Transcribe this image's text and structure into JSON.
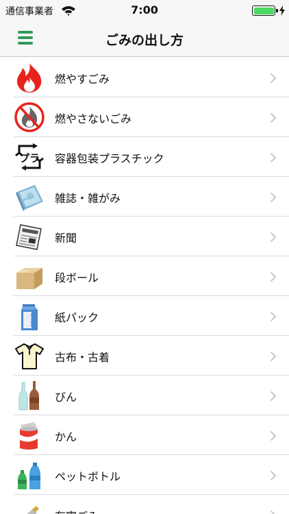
{
  "status_bar": {
    "carrier": "通信事業者",
    "time": "7:00",
    "battery_color": "#4cd964"
  },
  "nav": {
    "title": "ごみの出し方",
    "menu_icon": "hamburger-menu-icon",
    "accent_color": "#2e9a5c"
  },
  "categories": [
    {
      "label": "燃やすごみ",
      "icon": "flame-icon"
    },
    {
      "label": "燃やさないごみ",
      "icon": "no-burn-icon"
    },
    {
      "label": "容器包装プラスチック",
      "icon": "plastic-recycle-icon",
      "icon_text": "プラ"
    },
    {
      "label": "雑誌・雑がみ",
      "icon": "magazine-icon"
    },
    {
      "label": "新聞",
      "icon": "newspaper-icon"
    },
    {
      "label": "段ボール",
      "icon": "cardboard-box-icon"
    },
    {
      "label": "紙パック",
      "icon": "milk-carton-icon",
      "icon_text": "MILK"
    },
    {
      "label": "古布・古着",
      "icon": "shirt-icon"
    },
    {
      "label": "びん",
      "icon": "bottles-icon"
    },
    {
      "label": "かん",
      "icon": "cans-icon"
    },
    {
      "label": "ペットボトル",
      "icon": "pet-bottle-icon"
    },
    {
      "label": "有害ごみ",
      "icon": "hazardous-icon"
    }
  ]
}
